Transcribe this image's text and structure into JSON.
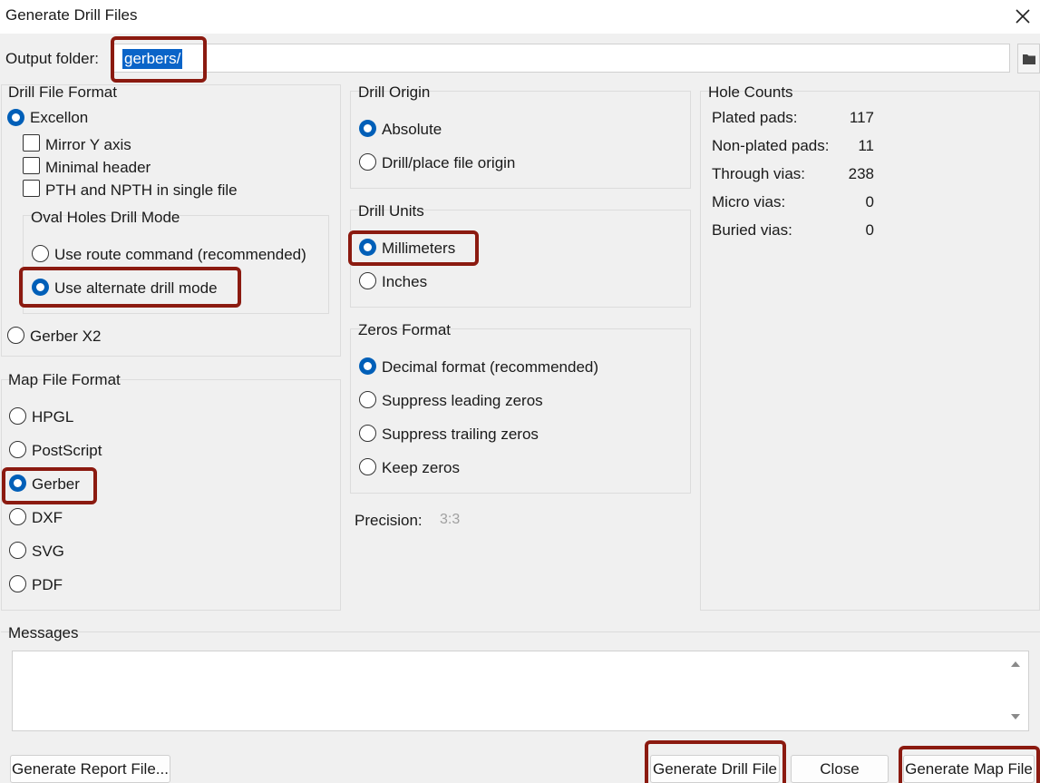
{
  "window": {
    "title": "Generate Drill Files"
  },
  "output": {
    "label": "Output folder:",
    "value": "gerbers/"
  },
  "drill_format": {
    "title": "Drill File Format",
    "excellon": "Excellon",
    "mirror_y": "Mirror Y axis",
    "minimal_header": "Minimal header",
    "pth_npth": "PTH and NPTH in single file",
    "oval_title": "Oval Holes Drill Mode",
    "route_cmd": "Use route command (recommended)",
    "alt_drill": "Use alternate drill mode",
    "gerber_x2": "Gerber X2"
  },
  "map_format": {
    "title": "Map File Format",
    "options": [
      "HPGL",
      "PostScript",
      "Gerber",
      "DXF",
      "SVG",
      "PDF"
    ],
    "selected": "Gerber"
  },
  "drill_origin": {
    "title": "Drill Origin",
    "absolute": "Absolute",
    "aux": "Drill/place file origin"
  },
  "drill_units": {
    "title": "Drill Units",
    "mm": "Millimeters",
    "inches": "Inches"
  },
  "zeros_format": {
    "title": "Zeros Format",
    "decimal": "Decimal format (recommended)",
    "leading": "Suppress leading zeros",
    "trailing": "Suppress trailing zeros",
    "keep": "Keep zeros"
  },
  "precision": {
    "label": "Precision:",
    "value": "3:3"
  },
  "hole_counts": {
    "title": "Hole Counts",
    "rows": [
      {
        "label": "Plated pads:",
        "value": "117"
      },
      {
        "label": "Non-plated pads:",
        "value": "11"
      },
      {
        "label": "Through vias:",
        "value": "238"
      },
      {
        "label": "Micro vias:",
        "value": "0"
      },
      {
        "label": "Buried vias:",
        "value": "0"
      }
    ]
  },
  "messages": {
    "title": "Messages"
  },
  "buttons": {
    "report": "Generate Report File...",
    "drill": "Generate Drill File",
    "close": "Close",
    "map": "Generate Map File"
  },
  "colors": {
    "accent": "#005fb8",
    "highlight": "#8b1a10",
    "selection": "#0a64c8"
  }
}
